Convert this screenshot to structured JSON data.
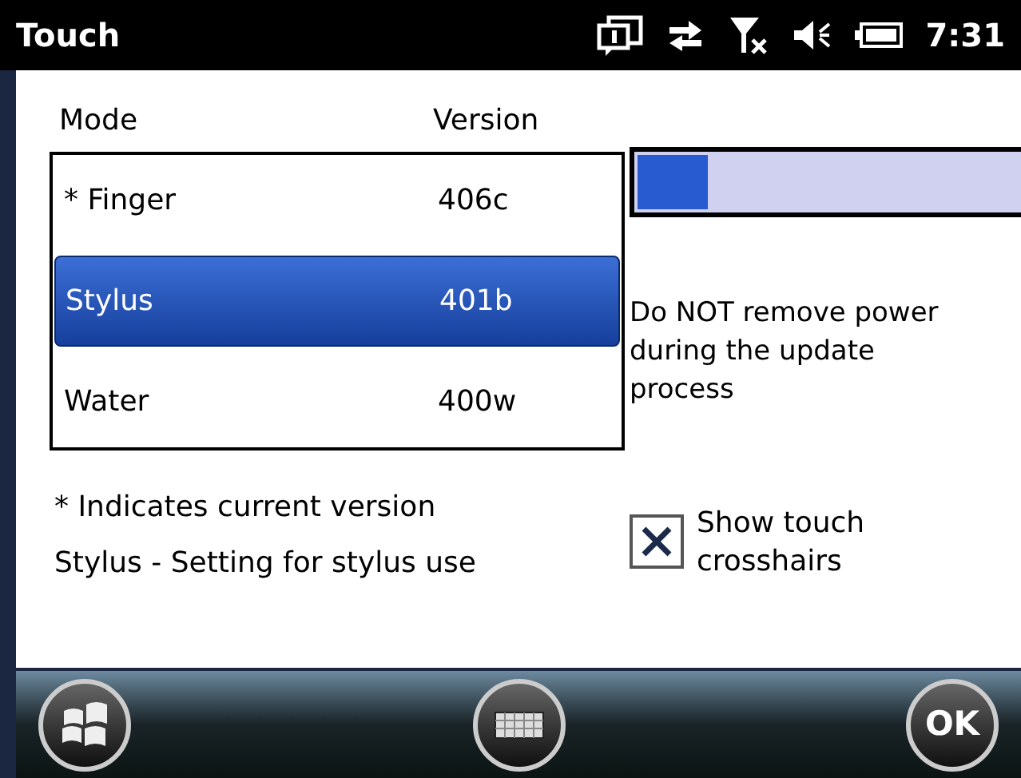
{
  "title_bar": {
    "title": "Touch",
    "time": "7:31"
  },
  "list": {
    "columns": [
      "Mode",
      "Version"
    ],
    "rows": [
      {
        "mode": "* Finger",
        "version": "406c",
        "selected": false
      },
      {
        "mode": "Stylus",
        "version": "401b",
        "selected": true
      },
      {
        "mode": "Water",
        "version": "400w",
        "selected": false
      }
    ]
  },
  "notes": [
    "* Indicates current version",
    "Stylus - Setting for stylus use"
  ],
  "progress": {
    "level": 0.15
  },
  "warning": "Do NOT remove power during the update process",
  "crosshairs": {
    "label": "Show touch crosshairs",
    "checked": true
  },
  "softkeys": {
    "ok": "OK"
  }
}
